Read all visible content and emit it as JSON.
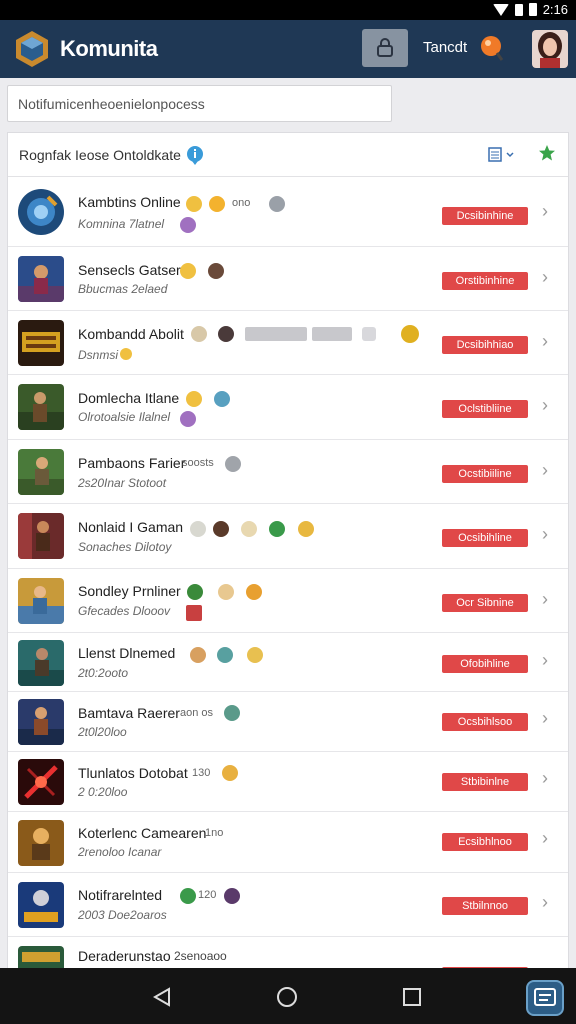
{
  "status": {
    "time": "2:16"
  },
  "app": {
    "title": "Komunita",
    "user_label": "Tancdt"
  },
  "search": {
    "placeholder": "Notifumicenheoenielonpocess"
  },
  "panel": {
    "title": "Rognfak Ieose Ontoldkate"
  },
  "rows": [
    {
      "name": "Kambtins Online",
      "extra": "ono",
      "sub": "Komnina 7latnel",
      "status": "Dcsibinhine"
    },
    {
      "name": "Sensecls Gatser",
      "extra": "",
      "sub": "Bbucmas 2elaed",
      "status": "Orstibinhine"
    },
    {
      "name": "Kombandd Abolit",
      "extra": "",
      "sub": "Dsnmsi",
      "status": "Dcsibihhiao"
    },
    {
      "name": "Domlecha Itlane",
      "extra": "",
      "sub": "Olrotoalsie Ilalnel",
      "status": "Oclstibliine"
    },
    {
      "name": "Pambaons Farier",
      "extra": "soosts",
      "sub": "2s20Inar Stotoot",
      "status": "Ocstibiiline"
    },
    {
      "name": "Nonlaid I Gaman",
      "extra": "",
      "sub": "Sonaches Dilotoy",
      "status": "Ocsibihline"
    },
    {
      "name": "Sondley Prnliner",
      "extra": "",
      "sub": "Gfecades Dlooov",
      "status": "Ocr Sibnine"
    },
    {
      "name": "Llenst Dlnemed",
      "extra": "",
      "sub": "2t0:2ooto",
      "status": "Ofobihline"
    },
    {
      "name": "Bamtava Raerer",
      "extra": "aon os",
      "sub": "2t0l20loo",
      "status": "Ocsbihlsoo"
    },
    {
      "name": "Tlunlatos Dotobat",
      "extra": "130",
      "sub": "2 0:20loo",
      "status": "Stbibinlne"
    },
    {
      "name": "Koterlenc Camearen",
      "extra": "1no",
      "sub": "2renoloo Icanar",
      "status": "Ecsibhlnoo"
    },
    {
      "name": "Notifrarelnted",
      "extra": "120",
      "sub": "2003 Doe2oaros",
      "status": "Stbilnnoo"
    },
    {
      "name": "Deraderunstao",
      "extra": "2senoaoo",
      "sub": "",
      "status": ""
    }
  ],
  "colors": {
    "appbar": "#1f3855",
    "pill": "#e04848",
    "accent_green": "#3aa44a"
  }
}
